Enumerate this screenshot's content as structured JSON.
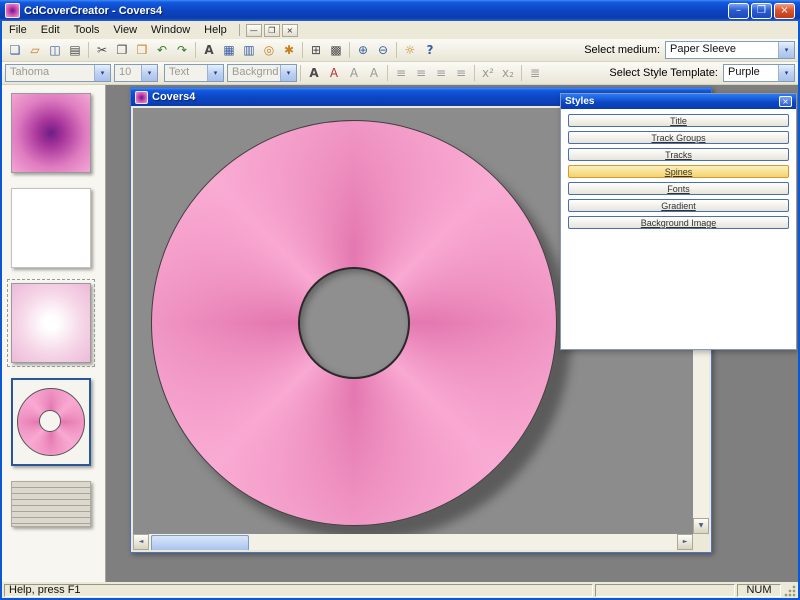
{
  "titlebar": {
    "title": "CdCoverCreator - Covers4",
    "minimize": "–",
    "maximize": "❐",
    "close": "×"
  },
  "menubar": {
    "items": [
      "File",
      "Edit",
      "Tools",
      "View",
      "Window",
      "Help"
    ],
    "mdi_minimize": "—",
    "mdi_restore": "❐",
    "mdi_close": "×"
  },
  "toolbar_main": {
    "icons": [
      {
        "name": "new-document-icon",
        "glyph": "❏"
      },
      {
        "name": "open-folder-icon",
        "glyph": "▱"
      },
      {
        "name": "save-icon",
        "glyph": "◫"
      },
      {
        "name": "print-icon",
        "glyph": "▤"
      },
      {
        "name": "cut-icon",
        "glyph": "✂"
      },
      {
        "name": "copy-icon",
        "glyph": "❐"
      },
      {
        "name": "paste-icon",
        "glyph": "❒"
      },
      {
        "name": "undo-icon",
        "glyph": "↶"
      },
      {
        "name": "redo-icon",
        "glyph": "↷"
      },
      {
        "name": "text-tool-icon",
        "glyph": "A"
      },
      {
        "name": "image-icon",
        "glyph": "▦"
      },
      {
        "name": "table-icon",
        "glyph": "▥"
      },
      {
        "name": "cd-icon",
        "glyph": "◎"
      },
      {
        "name": "wizard-icon",
        "glyph": "✱"
      },
      {
        "name": "grid-icon",
        "glyph": "⊞"
      },
      {
        "name": "chart-icon",
        "glyph": "▩"
      },
      {
        "name": "zoom-in-icon",
        "glyph": "⊕"
      },
      {
        "name": "zoom-out-icon",
        "glyph": "⊖"
      },
      {
        "name": "tip-icon",
        "glyph": "☼"
      },
      {
        "name": "help-icon",
        "glyph": "?"
      }
    ],
    "medium_label": "Select medium:",
    "medium_value": "Paper Sleeve"
  },
  "toolbar_format": {
    "font_name": "Tahoma",
    "font_size": "10",
    "text_combo": "Text",
    "background_combo": "Backgrnd",
    "buttons": [
      {
        "name": "bold-icon",
        "glyph": "A"
      },
      {
        "name": "font-color-icon",
        "glyph": "A"
      },
      {
        "name": "font-increase-icon",
        "glyph": "A"
      },
      {
        "name": "font-decrease-icon",
        "glyph": "A"
      },
      {
        "name": "align-left-icon",
        "glyph": "≡"
      },
      {
        "name": "align-center-icon",
        "glyph": "≡"
      },
      {
        "name": "align-right-icon",
        "glyph": "≡"
      },
      {
        "name": "align-justify-icon",
        "glyph": "≡"
      },
      {
        "name": "superscript-icon",
        "glyph": "x²"
      },
      {
        "name": "subscript-icon",
        "glyph": "x₂"
      },
      {
        "name": "list-icon",
        "glyph": "≣"
      }
    ],
    "template_label": "Select Style Template:",
    "template_value": "Purple"
  },
  "document": {
    "title": "Covers4"
  },
  "styles_panel": {
    "title": "Styles",
    "close": "×",
    "buttons": [
      {
        "label": "Title"
      },
      {
        "label": "Track Groups"
      },
      {
        "label": "Tracks"
      },
      {
        "label": "Spines"
      },
      {
        "label": "Fonts"
      },
      {
        "label": "Gradient"
      },
      {
        "label": "Background Image"
      }
    ]
  },
  "statusbar": {
    "help": "Help, press F1",
    "num": "NUM"
  },
  "ui": {
    "dropdown_glyph": "▾",
    "scroll_up": "▲",
    "scroll_down": "▼",
    "scroll_left": "◄",
    "scroll_right": "►"
  },
  "colors": {
    "titlebar_blue": "#0D47C6",
    "disc_pink_light": "#F9A9D2",
    "disc_pink_dark": "#E478B0",
    "selection_blue": "#2B5797",
    "active_style_border": "#D89A2A",
    "workspace_gray": "#7F7F7F"
  }
}
